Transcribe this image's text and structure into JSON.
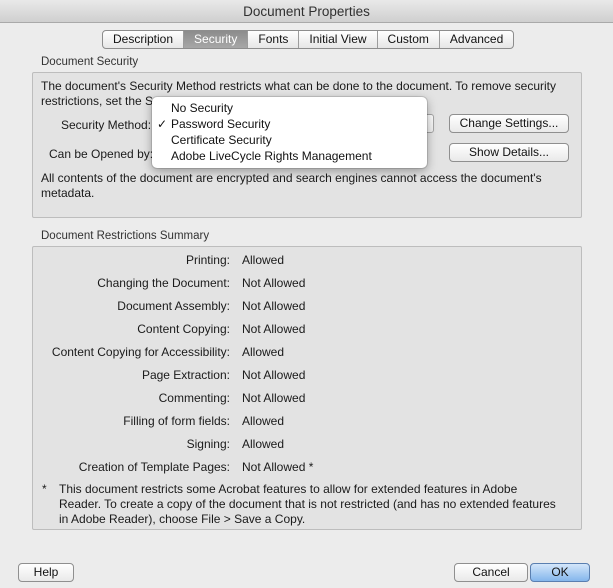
{
  "window": {
    "title": "Document Properties"
  },
  "tabs": [
    {
      "label": "Description",
      "active": false
    },
    {
      "label": "Security",
      "active": true
    },
    {
      "label": "Fonts",
      "active": false
    },
    {
      "label": "Initial View",
      "active": false
    },
    {
      "label": "Custom",
      "active": false
    },
    {
      "label": "Advanced",
      "active": false
    }
  ],
  "security": {
    "group_label": "Document Security",
    "intro_line1": "The document's Security Method restricts what can be done to the document. To remove security",
    "intro_line2": "restrictions, set the S",
    "method_label": "Security Method:",
    "opened_label": "Can be Opened by:",
    "change_settings": "Change Settings...",
    "show_details": "Show Details...",
    "note_line1": "All contents of the document are encrypted and search engines cannot access the document's",
    "note_line2": "metadata."
  },
  "menu": {
    "check": "✓",
    "items": [
      "No Security",
      "Password Security",
      "Certificate Security",
      "Adobe LiveCycle Rights Management"
    ],
    "selected_index": 1
  },
  "restrictions": {
    "group_label": "Document Restrictions Summary",
    "rows": [
      {
        "label": "Printing:",
        "value": "Allowed"
      },
      {
        "label": "Changing the Document:",
        "value": "Not Allowed"
      },
      {
        "label": "Document Assembly:",
        "value": "Not Allowed"
      },
      {
        "label": "Content Copying:",
        "value": "Not Allowed"
      },
      {
        "label": "Content Copying for Accessibility:",
        "value": "Allowed"
      },
      {
        "label": "Page Extraction:",
        "value": "Not Allowed"
      },
      {
        "label": "Commenting:",
        "value": "Not Allowed"
      },
      {
        "label": "Filling of form fields:",
        "value": "Allowed"
      },
      {
        "label": "Signing:",
        "value": "Allowed"
      },
      {
        "label": "Creation of Template Pages:",
        "value": "Not Allowed *"
      }
    ],
    "footnote_star": "*",
    "footnote_line1": "This document restricts some Acrobat features to allow for extended features in Adobe",
    "footnote_line2": "Reader. To create a copy of the document that is not restricted (and has no extended features",
    "footnote_line3": "in Adobe Reader), choose File > Save a Copy."
  },
  "buttons": {
    "help": "Help",
    "cancel": "Cancel",
    "ok": "OK"
  }
}
